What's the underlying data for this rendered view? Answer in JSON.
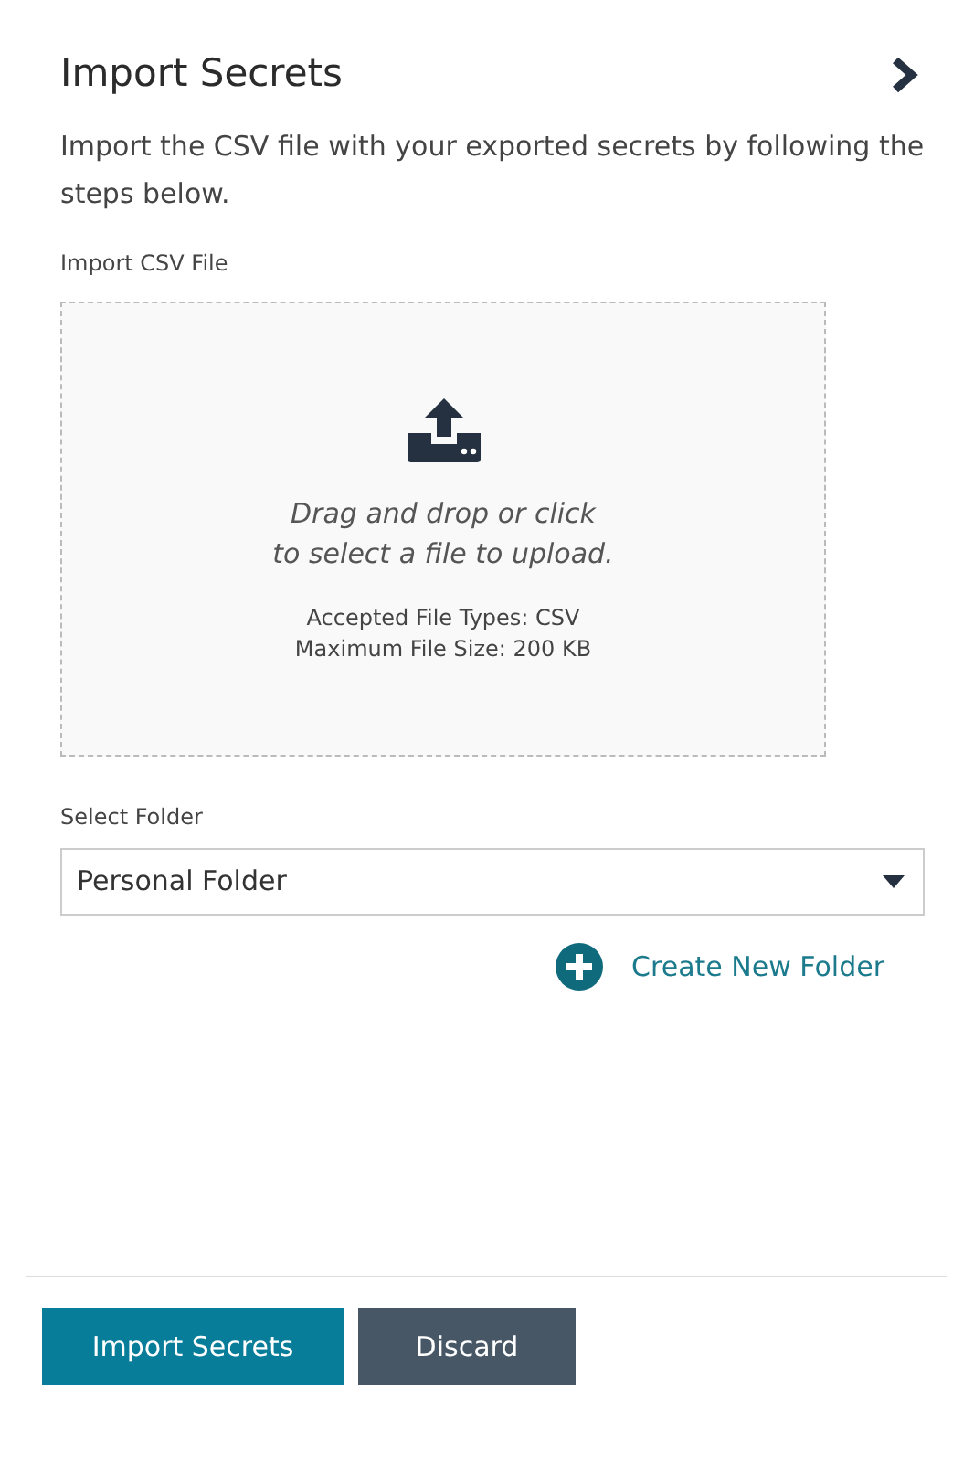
{
  "panel": {
    "title": "Import Secrets",
    "description": "Import the CSV file with your exported secrets by following the steps below."
  },
  "upload": {
    "label": "Import CSV File",
    "prompt_lines": [
      "Drag and drop or click",
      "to select a file to upload."
    ],
    "info_lines": [
      "Accepted File Types: CSV",
      "Maximum File Size: 200 KB"
    ]
  },
  "folder": {
    "label": "Select Folder",
    "value": "Personal Folder",
    "create_link": "Create New Folder"
  },
  "buttons": [
    {
      "label": "Import Secrets",
      "kind": "primary"
    },
    {
      "label": "Discard",
      "kind": "secondary"
    }
  ]
}
